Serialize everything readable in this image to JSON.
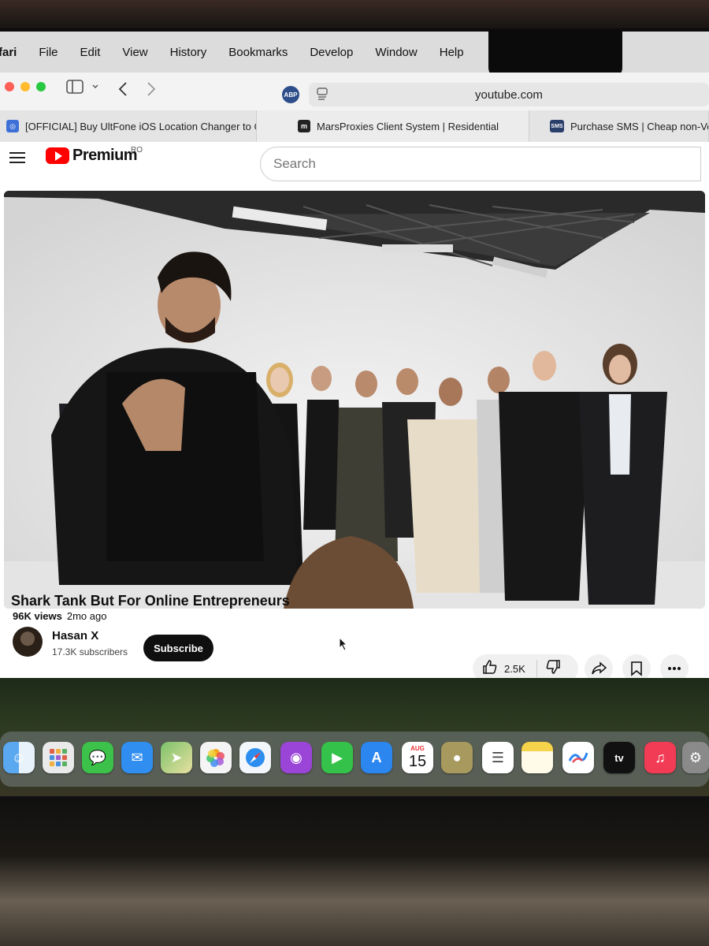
{
  "menubar": {
    "app_name": "fari",
    "items": [
      "File",
      "Edit",
      "View",
      "History",
      "Bookmarks",
      "Develop",
      "Window",
      "Help"
    ]
  },
  "toolbar": {
    "adblock_label": "ABP",
    "url": "youtube.com"
  },
  "tabs": [
    {
      "title": "[OFFICIAL] Buy UltFone iOS Location Changer to Ch..."
    },
    {
      "title": "MarsProxies Client System | Residential"
    },
    {
      "title": "Purchase SMS | Cheap non-VoIP s",
      "favicon_text": "SMS"
    }
  ],
  "youtube": {
    "brand": "Premium",
    "region": "RO",
    "search_placeholder": "Search",
    "video": {
      "title": "Shark Tank But For Online Entrepreneurs",
      "views": "96K views",
      "age": "2mo ago",
      "channel_name": "Hasan X",
      "subscribers": "17.3K subscribers",
      "subscribe_label": "Subscribe",
      "likes": "2.5K"
    },
    "accent_color": "#ff0000"
  },
  "dock": {
    "calendar_month": "AUG",
    "calendar_day": "15",
    "tv_label": "tv"
  }
}
